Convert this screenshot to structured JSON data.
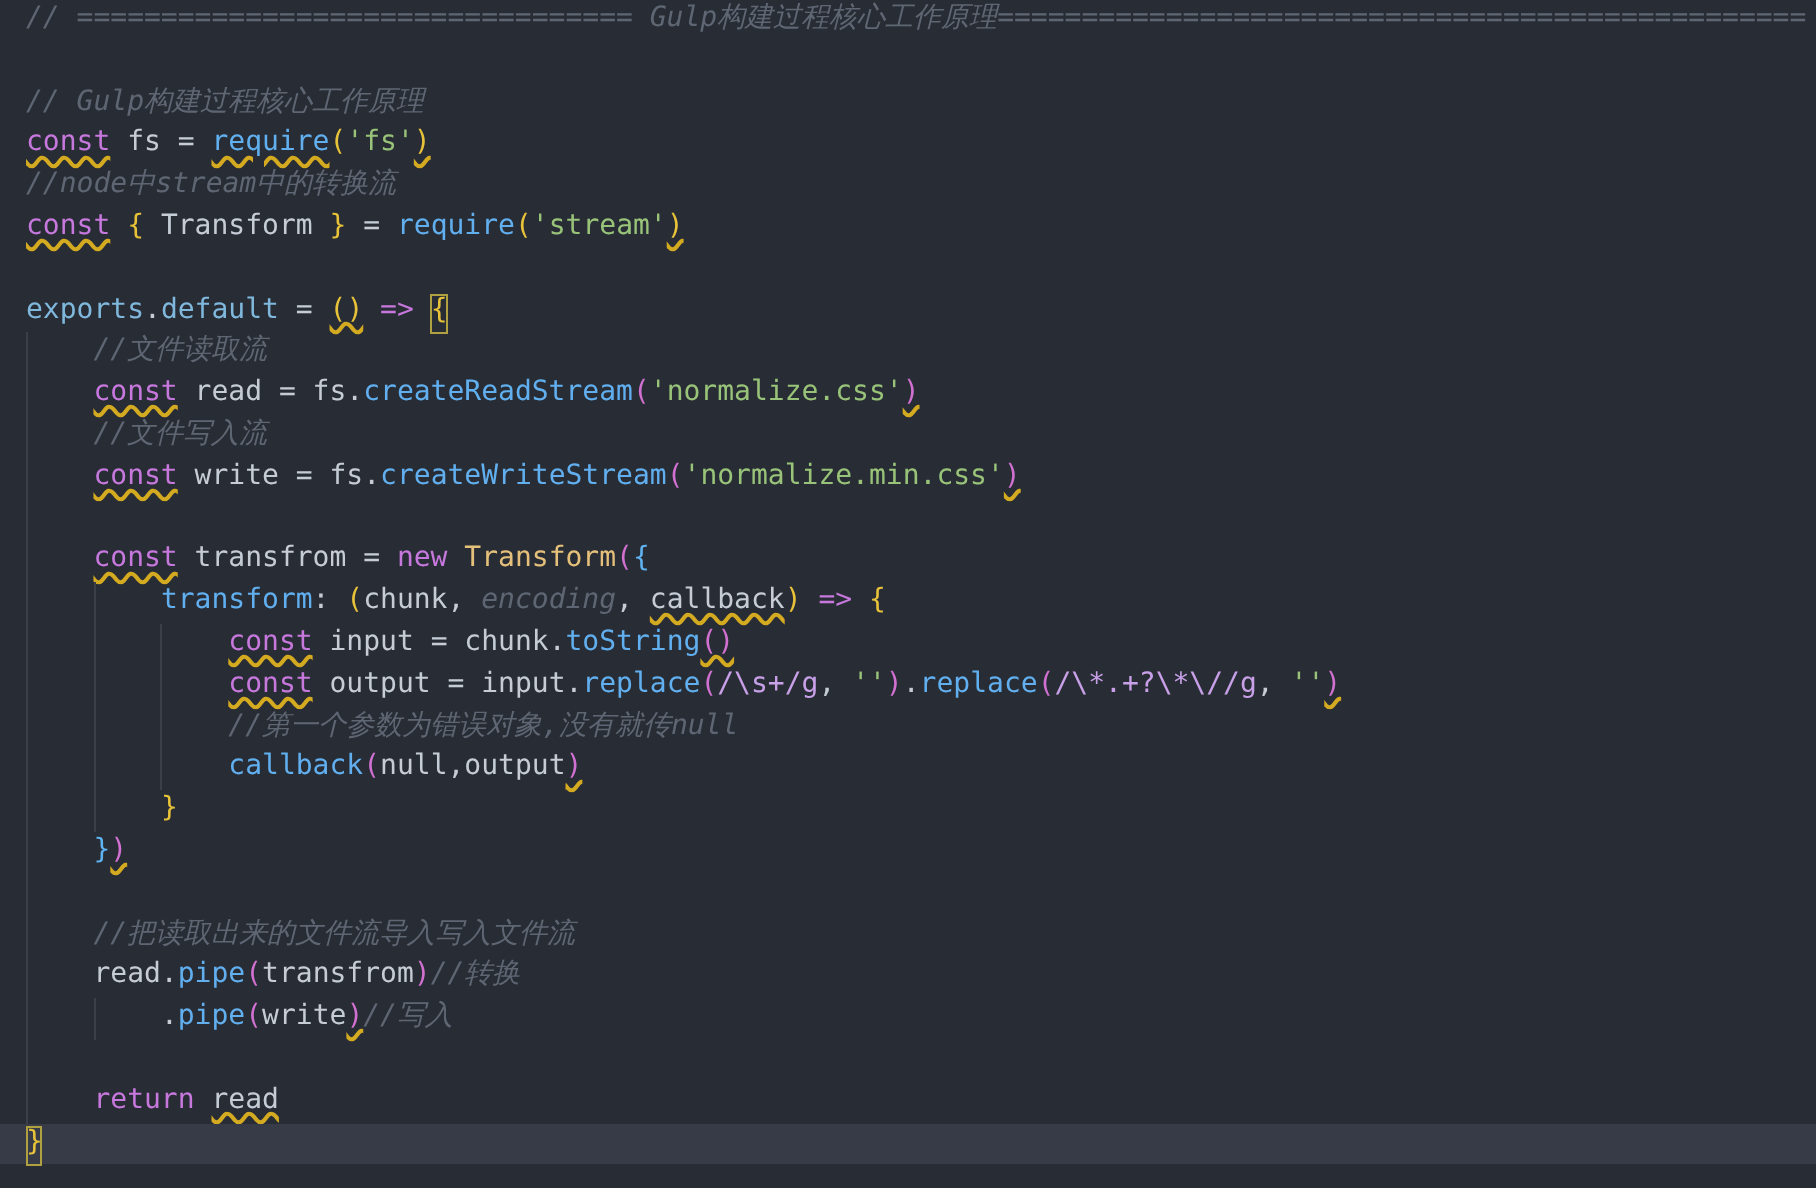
{
  "editor": {
    "lines": [
      {
        "current": false,
        "tokens": [
          {
            "text": "// ================================= Gulp构建过程核心工作原理================================================",
            "kind": "comment"
          }
        ]
      },
      {
        "current": false
      },
      {
        "current": false,
        "tokens": [
          {
            "text": "// Gulp构建过程核心工作原理",
            "kind": "comment"
          }
        ]
      },
      {
        "current": false,
        "tokens": [
          {
            "text": "const",
            "kind": "keyword",
            "squiggle": true
          },
          {
            "text": " fs = ",
            "kind": "plain"
          },
          {
            "text": "require",
            "kind": "function",
            "squiggle": true
          },
          {
            "text": "(",
            "kind": "bracket1"
          },
          {
            "text": "'fs'",
            "kind": "string"
          },
          {
            "text": ")",
            "kind": "bracket1",
            "squiggle": true
          }
        ]
      },
      {
        "current": false,
        "tokens": [
          {
            "text": "//node中stream中的转换流",
            "kind": "comment"
          }
        ]
      },
      {
        "current": false,
        "tokens": [
          {
            "text": "const",
            "kind": "keyword",
            "squiggle": true
          },
          {
            "text": " {",
            "kind": "bracket1"
          },
          {
            "text": " Transform ",
            "kind": "plain"
          },
          {
            "text": "}",
            "kind": "bracket1"
          },
          {
            "text": " = ",
            "kind": "plain"
          },
          {
            "text": "require",
            "kind": "function"
          },
          {
            "text": "(",
            "kind": "bracket1"
          },
          {
            "text": "'stream'",
            "kind": "string"
          },
          {
            "text": ")",
            "kind": "bracket1",
            "squiggle": true
          }
        ]
      },
      {
        "current": false
      },
      {
        "current": false,
        "tokens": [
          {
            "text": "exports",
            "kind": "property"
          },
          {
            "text": ".",
            "kind": "plain"
          },
          {
            "text": "default",
            "kind": "property"
          },
          {
            "text": " = ",
            "kind": "plain"
          },
          {
            "text": "()",
            "kind": "bracket1",
            "squiggle": true
          },
          {
            "text": " => ",
            "kind": "keyword"
          },
          {
            "text": "{",
            "kind": "bracket1",
            "match": true
          }
        ],
        "children": [
          {
            "current": false,
            "tokens": [
              {
                "text": "//文件读取流",
                "kind": "comment"
              }
            ]
          },
          {
            "current": false,
            "tokens": [
              {
                "text": "const",
                "kind": "keyword",
                "squiggle": true
              },
              {
                "text": " read = fs.",
                "kind": "plain"
              },
              {
                "text": "createReadStream",
                "kind": "function"
              },
              {
                "text": "(",
                "kind": "bracket2"
              },
              {
                "text": "'normalize.css'",
                "kind": "string"
              },
              {
                "text": ")",
                "kind": "bracket2",
                "squiggle": true
              }
            ]
          },
          {
            "current": false,
            "tokens": [
              {
                "text": "//文件写入流",
                "kind": "comment"
              }
            ]
          },
          {
            "current": false,
            "tokens": [
              {
                "text": "const",
                "kind": "keyword",
                "squiggle": true
              },
              {
                "text": " write = fs.",
                "kind": "plain"
              },
              {
                "text": "createWriteStream",
                "kind": "function"
              },
              {
                "text": "(",
                "kind": "bracket2"
              },
              {
                "text": "'normalize.min.css'",
                "kind": "string"
              },
              {
                "text": ")",
                "kind": "bracket2",
                "squiggle": true
              }
            ]
          },
          {
            "current": false
          },
          {
            "current": false,
            "tokens": [
              {
                "text": "const",
                "kind": "keyword",
                "squiggle": true
              },
              {
                "text": " transfrom = ",
                "kind": "plain"
              },
              {
                "text": "new ",
                "kind": "keyword"
              },
              {
                "text": "Transform",
                "kind": "class"
              },
              {
                "text": "(",
                "kind": "bracket2"
              },
              {
                "text": "{",
                "kind": "bracket3"
              }
            ],
            "children": [
              {
                "current": false,
                "tokens": [
                  {
                    "text": "transform",
                    "kind": "function"
                  },
                  {
                    "text": ": ",
                    "kind": "plain"
                  },
                  {
                    "text": "(",
                    "kind": "bracket1"
                  },
                  {
                    "text": "chunk, ",
                    "kind": "plain"
                  },
                  {
                    "text": "encoding",
                    "kind": "unused"
                  },
                  {
                    "text": ", ",
                    "kind": "plain"
                  },
                  {
                    "text": "callback",
                    "kind": "plain",
                    "squiggle": true
                  },
                  {
                    "text": ")",
                    "kind": "bracket1"
                  },
                  {
                    "text": " => ",
                    "kind": "keyword"
                  },
                  {
                    "text": "{",
                    "kind": "bracket1"
                  }
                ],
                "children": [
                  {
                    "current": false,
                    "tokens": [
                      {
                        "text": "const",
                        "kind": "keyword",
                        "squiggle": true
                      },
                      {
                        "text": " input = chunk.",
                        "kind": "plain"
                      },
                      {
                        "text": "toString",
                        "kind": "function"
                      },
                      {
                        "text": "()",
                        "kind": "bracket2",
                        "squiggle": true
                      }
                    ]
                  },
                  {
                    "current": false,
                    "tokens": [
                      {
                        "text": "const",
                        "kind": "keyword",
                        "squiggle": true
                      },
                      {
                        "text": " output = input.",
                        "kind": "plain"
                      },
                      {
                        "text": "replace",
                        "kind": "function"
                      },
                      {
                        "text": "(",
                        "kind": "bracket2"
                      },
                      {
                        "text": "/\\s+/g",
                        "kind": "regex"
                      },
                      {
                        "text": ", ",
                        "kind": "plain"
                      },
                      {
                        "text": "''",
                        "kind": "string"
                      },
                      {
                        "text": ")",
                        "kind": "bracket2"
                      },
                      {
                        "text": ".",
                        "kind": "plain"
                      },
                      {
                        "text": "replace",
                        "kind": "function"
                      },
                      {
                        "text": "(",
                        "kind": "bracket2"
                      },
                      {
                        "text": "/\\*.+?\\*\\//g",
                        "kind": "regex"
                      },
                      {
                        "text": ", ",
                        "kind": "plain"
                      },
                      {
                        "text": "''",
                        "kind": "string"
                      },
                      {
                        "text": ")",
                        "kind": "bracket2",
                        "squiggle": true
                      }
                    ]
                  },
                  {
                    "current": false,
                    "tokens": [
                      {
                        "text": "//第一个参数为错误对象,没有就传null",
                        "kind": "comment"
                      }
                    ]
                  },
                  {
                    "current": false,
                    "tokens": [
                      {
                        "text": "callback",
                        "kind": "function"
                      },
                      {
                        "text": "(",
                        "kind": "bracket2"
                      },
                      {
                        "text": "null,output",
                        "kind": "plain"
                      },
                      {
                        "text": ")",
                        "kind": "bracket2",
                        "squiggle": true
                      }
                    ]
                  }
                ]
              },
              {
                "current": false,
                "tokens": [
                  {
                    "text": "}",
                    "kind": "bracket1"
                  }
                ]
              }
            ]
          },
          {
            "current": false,
            "tokens": [
              {
                "text": "}",
                "kind": "bracket3"
              },
              {
                "text": ")",
                "kind": "bracket2",
                "squiggle": true
              }
            ]
          },
          {
            "current": false
          },
          {
            "current": false,
            "tokens": [
              {
                "text": "//把读取出来的文件流导入写入文件流",
                "kind": "comment"
              }
            ]
          },
          {
            "current": false,
            "tokens": [
              {
                "text": "read.",
                "kind": "plain"
              },
              {
                "text": "pipe",
                "kind": "function"
              },
              {
                "text": "(",
                "kind": "bracket2"
              },
              {
                "text": "transfrom",
                "kind": "plain"
              },
              {
                "text": ")",
                "kind": "bracket2"
              },
              {
                "text": "//转换",
                "kind": "comment"
              }
            ],
            "children": [
              {
                "current": false,
                "tokens": [
                  {
                    "text": ".",
                    "kind": "plain"
                  },
                  {
                    "text": "pipe",
                    "kind": "function"
                  },
                  {
                    "text": "(",
                    "kind": "bracket2"
                  },
                  {
                    "text": "write",
                    "kind": "plain"
                  },
                  {
                    "text": ")",
                    "kind": "bracket2",
                    "squiggle": true
                  },
                  {
                    "text": "//写入",
                    "kind": "comment"
                  }
                ]
              }
            ]
          },
          {
            "current": false
          },
          {
            "current": false,
            "tokens": [
              {
                "text": "return ",
                "kind": "keyword"
              },
              {
                "text": "read",
                "kind": "plain",
                "squiggle": true
              }
            ]
          }
        ]
      },
      {
        "current": true,
        "tokens": [
          {
            "text": "}",
            "kind": "bracket1",
            "match": true
          }
        ]
      }
    ]
  }
}
